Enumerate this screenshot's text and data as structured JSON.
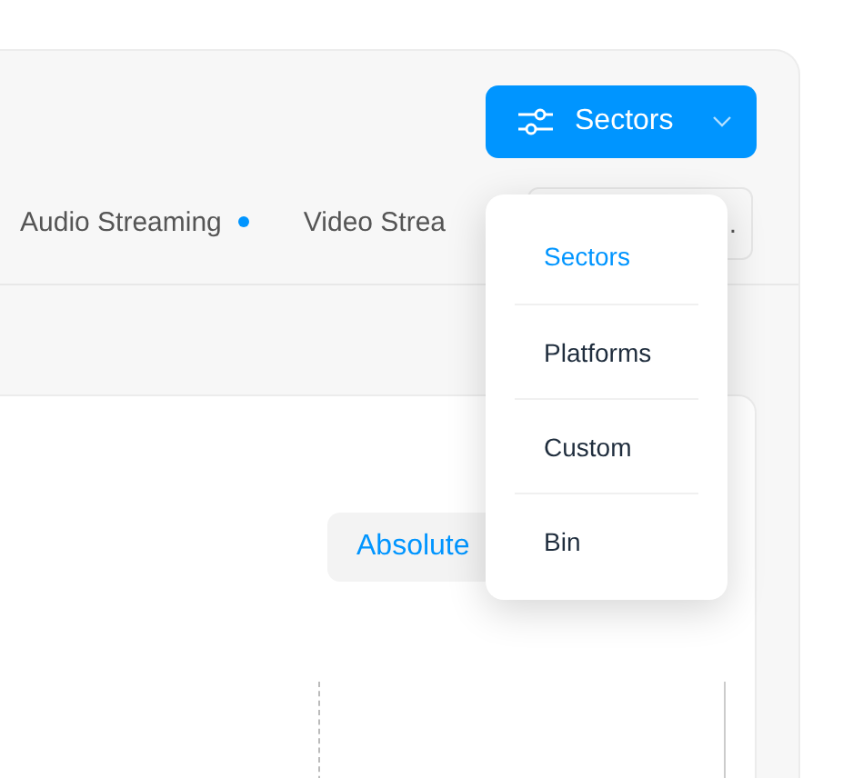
{
  "filter_button": {
    "label": "Sectors",
    "expanded": true
  },
  "tabs": [
    {
      "label": "Audio Streaming",
      "badge": true
    },
    {
      "label": "Video Strea",
      "badge": false
    }
  ],
  "more_tab": {
    "label": "."
  },
  "mode_toggle": {
    "label": "Absolute",
    "selected": true
  },
  "menu": {
    "items": [
      {
        "label": "Sectors",
        "selected": true
      },
      {
        "label": "Platforms",
        "selected": false
      },
      {
        "label": "Custom",
        "selected": false
      },
      {
        "label": "Bin",
        "selected": false
      }
    ]
  }
}
